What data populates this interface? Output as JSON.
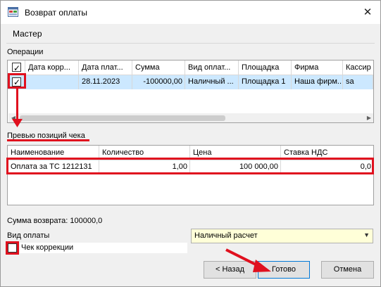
{
  "window": {
    "title": "Возврат оплаты",
    "close_glyph": "✕"
  },
  "wizard": {
    "label": "Мастер"
  },
  "operations": {
    "label": "Операции",
    "columns": [
      "Дата корр...",
      "Дата плат...",
      "Сумма",
      "Вид оплат...",
      "Площадка",
      "Фирма",
      "Кассир"
    ],
    "rows": [
      {
        "checked": true,
        "cells": [
          "",
          "28.11.2023",
          "-100000,00",
          "Наличный ...",
          "Площадка 1",
          "Наша фирм...",
          "sa"
        ]
      }
    ]
  },
  "preview": {
    "label": "Превью позиций чека",
    "columns": [
      "Наименование",
      "Количество",
      "Цена",
      "Ставка НДС"
    ],
    "rows": [
      {
        "cells": [
          "Оплата за ТС 1212131",
          "1,00",
          "100 000,00",
          "0,0"
        ]
      }
    ]
  },
  "refund_sum": {
    "text": "Сумма возврата: 100000,0"
  },
  "payment_type": {
    "label": "Вид оплаты",
    "value": "Наличный расчет"
  },
  "correction": {
    "label": "Чек коррекции",
    "checked": false
  },
  "buttons": {
    "back": "< Назад",
    "done": "Готово",
    "cancel": "Отмена"
  },
  "colors": {
    "accent_red": "#e0101e",
    "selection": "#cce8ff",
    "combo_bg": "#ffffd8"
  },
  "icons": {
    "app": "window-form-icon",
    "close": "close-icon",
    "combo": "chevron-down-icon"
  }
}
